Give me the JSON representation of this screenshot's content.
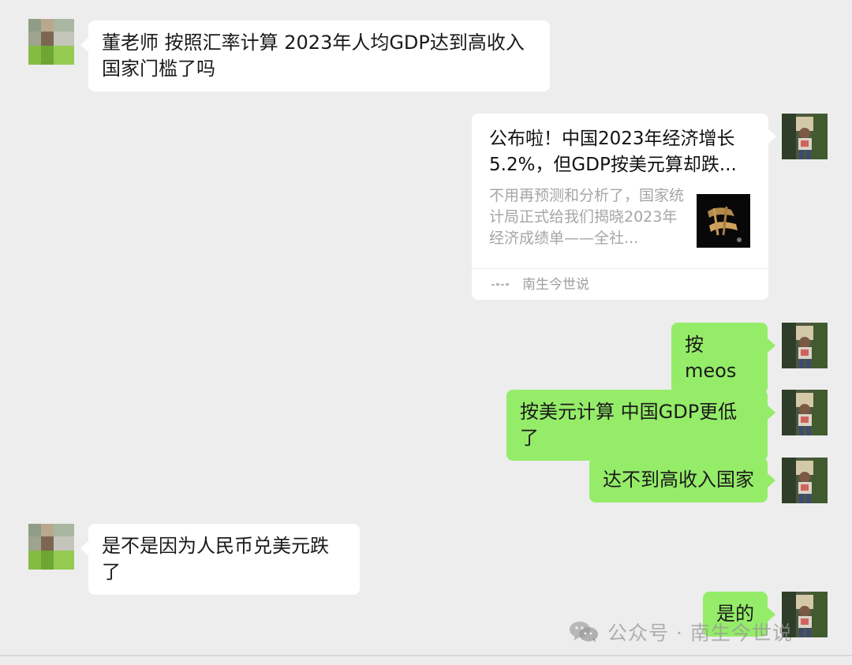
{
  "chat": {
    "messages": [
      {
        "side": "left",
        "text": "董老师 按照汇率计算 2023年人均GDP达到高收入国家门槛了吗"
      },
      {
        "side": "right",
        "type": "card",
        "title": "公布啦！中国2023年经济增长5.2%，但GDP按美元算却跌...",
        "summary": "不用再预测和分析了，国家统计局正式给我们揭晓2023年经济成绩单——全社...",
        "source": "南生今世说"
      },
      {
        "side": "right",
        "text": "按meos"
      },
      {
        "side": "right",
        "text": "按美元计算 中国GDP更低了"
      },
      {
        "side": "right",
        "text": "达不到高收入国家"
      },
      {
        "side": "left",
        "text": "是不是因为人民币兑美元跌了"
      },
      {
        "side": "right",
        "text": "是的"
      }
    ]
  },
  "watermark": {
    "text": "公众号 · 南生今世说",
    "icon": "wechat-icon"
  },
  "colors": {
    "background": "#ededed",
    "self_bubble": "#95ec69",
    "other_bubble": "#ffffff"
  },
  "avatars": {
    "other": "blurred-avatar-icon",
    "self": "child-photo-avatar-icon"
  }
}
